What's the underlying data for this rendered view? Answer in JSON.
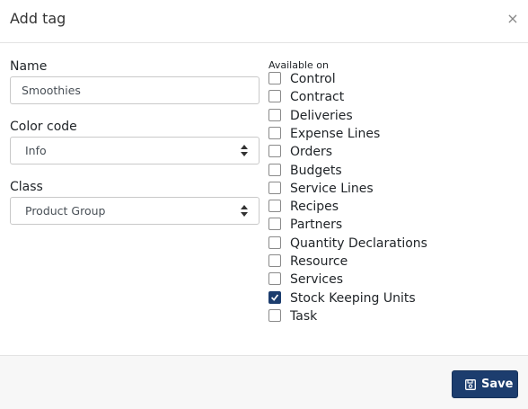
{
  "dialog": {
    "title": "Add tag",
    "close_icon": "close-icon",
    "close_glyph": "×"
  },
  "form": {
    "name": {
      "label": "Name",
      "value": "Smoothies"
    },
    "color_code": {
      "label": "Color code",
      "value": "Info"
    },
    "class": {
      "label": "Class",
      "value": "Product Group"
    }
  },
  "available_on": {
    "label": "Available on",
    "items": [
      {
        "label": "Control",
        "checked": false
      },
      {
        "label": "Contract",
        "checked": false
      },
      {
        "label": "Deliveries",
        "checked": false
      },
      {
        "label": "Expense Lines",
        "checked": false
      },
      {
        "label": "Orders",
        "checked": false
      },
      {
        "label": "Budgets",
        "checked": false
      },
      {
        "label": "Service Lines",
        "checked": false
      },
      {
        "label": "Recipes",
        "checked": false
      },
      {
        "label": "Partners",
        "checked": false
      },
      {
        "label": "Quantity Declarations",
        "checked": false
      },
      {
        "label": "Resource",
        "checked": false
      },
      {
        "label": "Services",
        "checked": false
      },
      {
        "label": "Stock Keeping Units",
        "checked": true
      },
      {
        "label": "Task",
        "checked": false
      }
    ]
  },
  "footer": {
    "save_label": "Save",
    "save_icon": "floppy-disk-icon"
  },
  "colors": {
    "primary": "#1c3d6e",
    "border": "#c9c9c9",
    "footer_bg": "#f7f7f7"
  }
}
